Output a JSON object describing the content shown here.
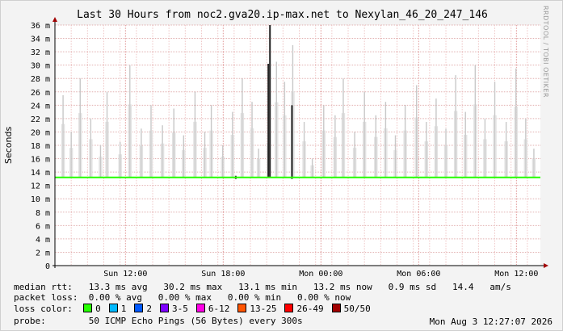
{
  "title": "Last 30 Hours from noc2.gva20.ip-max.net to Nexylan_46_20_247_146",
  "watermark": "RRDTOOL / TOBI OETIKER",
  "chart_data": {
    "type": "line",
    "ylabel": "Seconds",
    "ylim_ms": [
      0,
      36
    ],
    "y_ticks": [
      "0",
      "2 m",
      "4 m",
      "6 m",
      "8 m",
      "10 m",
      "12 m",
      "14 m",
      "16 m",
      "18 m",
      "20 m",
      "22 m",
      "24 m",
      "26 m",
      "28 m",
      "30 m",
      "32 m",
      "34 m",
      "36 m"
    ],
    "x_ticks": [
      "Sun 12:00",
      "Sun 18:00",
      "Mon 00:00",
      "Mon 06:00",
      "Mon 12:00"
    ],
    "x_tick_hours": [
      4.33,
      10.33,
      16.33,
      22.33,
      28.33
    ],
    "x_range_hours": [
      0,
      29.8
    ],
    "grid": true,
    "median_rtt_ms": 13.2,
    "spikes": [
      {
        "h": 0.5,
        "top": 25.5
      },
      {
        "h": 1.0,
        "top": 20.0
      },
      {
        "h": 1.55,
        "top": 28.0
      },
      {
        "h": 2.2,
        "top": 22.0
      },
      {
        "h": 2.8,
        "top": 18.0
      },
      {
        "h": 3.2,
        "top": 26.0
      },
      {
        "h": 4.0,
        "top": 18.5
      },
      {
        "h": 4.6,
        "top": 30.0
      },
      {
        "h": 5.3,
        "top": 20.5
      },
      {
        "h": 5.9,
        "top": 24.0
      },
      {
        "h": 6.6,
        "top": 21.0
      },
      {
        "h": 7.3,
        "top": 23.5
      },
      {
        "h": 7.9,
        "top": 19.5
      },
      {
        "h": 8.6,
        "top": 26.0
      },
      {
        "h": 9.2,
        "top": 20.0
      },
      {
        "h": 9.6,
        "top": 24.0
      },
      {
        "h": 10.3,
        "top": 18.0
      },
      {
        "h": 10.9,
        "top": 23.0
      },
      {
        "h": 11.5,
        "top": 28.0
      },
      {
        "h": 12.1,
        "top": 24.5
      },
      {
        "h": 12.5,
        "top": 17.5
      },
      {
        "h": 13.1,
        "top": 21.0
      },
      {
        "h": 13.6,
        "top": 30.5
      },
      {
        "h": 14.1,
        "top": 27.5
      },
      {
        "h": 14.6,
        "top": 33.0
      },
      {
        "h": 15.3,
        "top": 21.5
      },
      {
        "h": 15.8,
        "top": 16.0
      },
      {
        "h": 16.5,
        "top": 24.0
      },
      {
        "h": 17.2,
        "top": 22.5
      },
      {
        "h": 17.7,
        "top": 28.0
      },
      {
        "h": 18.4,
        "top": 20.0
      },
      {
        "h": 19.0,
        "top": 26.0
      },
      {
        "h": 19.7,
        "top": 22.5
      },
      {
        "h": 20.3,
        "top": 24.5
      },
      {
        "h": 20.9,
        "top": 19.5
      },
      {
        "h": 21.5,
        "top": 24.0
      },
      {
        "h": 22.2,
        "top": 27.0
      },
      {
        "h": 22.8,
        "top": 21.5
      },
      {
        "h": 23.4,
        "top": 25.0
      },
      {
        "h": 24.0,
        "top": 20.5
      },
      {
        "h": 24.6,
        "top": 28.5
      },
      {
        "h": 25.2,
        "top": 23.0
      },
      {
        "h": 25.8,
        "top": 30.0
      },
      {
        "h": 26.4,
        "top": 22.0
      },
      {
        "h": 27.0,
        "top": 27.5
      },
      {
        "h": 27.7,
        "top": 21.5
      },
      {
        "h": 28.3,
        "top": 29.5
      },
      {
        "h": 28.9,
        "top": 22.0
      },
      {
        "h": 29.4,
        "top": 17.5
      }
    ],
    "dark_spikes": [
      {
        "h": 13.1,
        "top": 30.2
      },
      {
        "h": 13.2,
        "top": 36.0
      },
      {
        "h": 14.55,
        "top": 24.0
      }
    ],
    "loss_ticks": [
      {
        "h": 11.1
      },
      {
        "h": 14.55
      }
    ]
  },
  "legend": {
    "median_rtt": "median rtt:   13.3 ms avg   30.2 ms max   13.1 ms min   13.2 ms now   0.9 ms sd   14.4   am/s",
    "packet_loss": "packet loss:  0.00 % avg   0.00 % max   0.00 % min   0.00 % now",
    "loss_color_label": "loss color:",
    "loss_colors": [
      {
        "label": "0",
        "color": "#26ff00"
      },
      {
        "label": "1",
        "color": "#00b8ff"
      },
      {
        "label": "2",
        "color": "#0059ff"
      },
      {
        "label": "3-5",
        "color": "#7e00ff"
      },
      {
        "label": "6-12",
        "color": "#ff00e6"
      },
      {
        "label": "13-25",
        "color": "#ff5500"
      },
      {
        "label": "26-49",
        "color": "#ff0000"
      },
      {
        "label": "50/50",
        "color": "#a10000"
      }
    ],
    "probe": "probe:        50 ICMP Echo Pings (56 Bytes) every 300s",
    "timestamp": "Mon Aug  3 12:27:07 2026"
  }
}
